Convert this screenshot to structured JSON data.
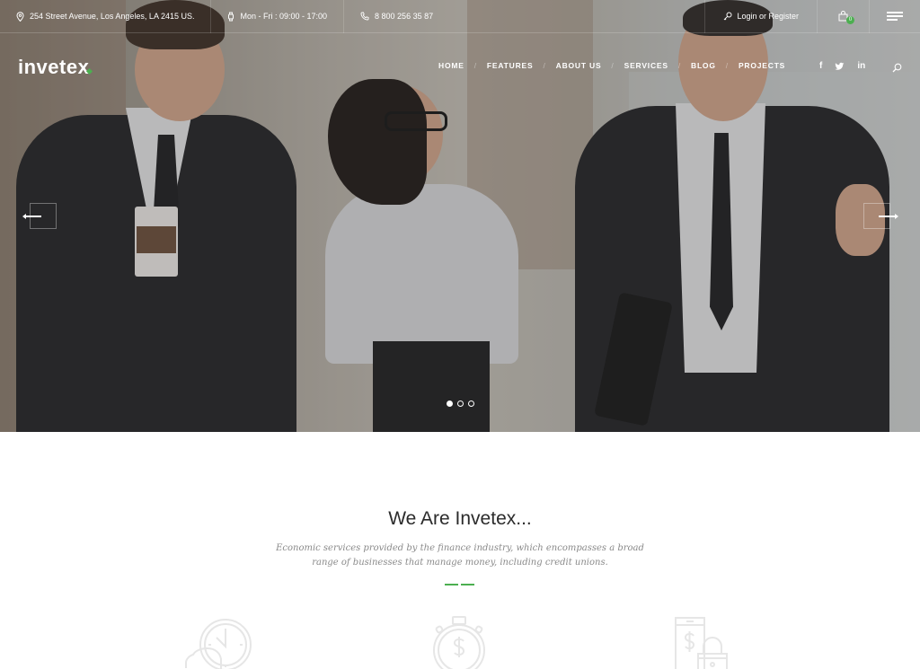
{
  "topbar": {
    "address": "254 Street Avenue, Los Angeles, LA 2415 US.",
    "hours": "Mon - Fri : 09:00 - 17:00",
    "phone": "8 800 256 35 87",
    "login": "Login or Register",
    "cart_count": "0",
    "icons": {
      "address": "map-pin-icon",
      "hours": "watch-icon",
      "phone": "phone-icon",
      "login": "key-icon",
      "cart": "shopping-bag-icon",
      "menu": "hamburger-menu-icon"
    }
  },
  "header": {
    "logo": "invetex",
    "nav": [
      {
        "label": "HOME"
      },
      {
        "label": "FEATURES"
      },
      {
        "label": "ABOUT US"
      },
      {
        "label": "SERVICES"
      },
      {
        "label": "BLOG"
      },
      {
        "label": "PROJECTS"
      }
    ],
    "social": [
      {
        "name": "facebook",
        "glyph": "f"
      },
      {
        "name": "twitter",
        "glyph": "t"
      },
      {
        "name": "linkedin",
        "glyph": "in"
      }
    ],
    "search_icon": "search-icon"
  },
  "slider": {
    "slide_count": 3,
    "active_slide": 1,
    "prev_icon": "arrow-left-icon",
    "next_icon": "arrow-right-icon"
  },
  "intro": {
    "title": "We Are Invetex...",
    "description": "Economic services provided by the finance industry, which encompasses a broad range of businesses that manage money, including credit unions.",
    "accent_color": "#4caf50"
  },
  "features": [
    {
      "icon": "clock-piggy-bank-icon"
    },
    {
      "icon": "stopwatch-dollar-icon"
    },
    {
      "icon": "phone-lock-dollar-icon"
    }
  ]
}
